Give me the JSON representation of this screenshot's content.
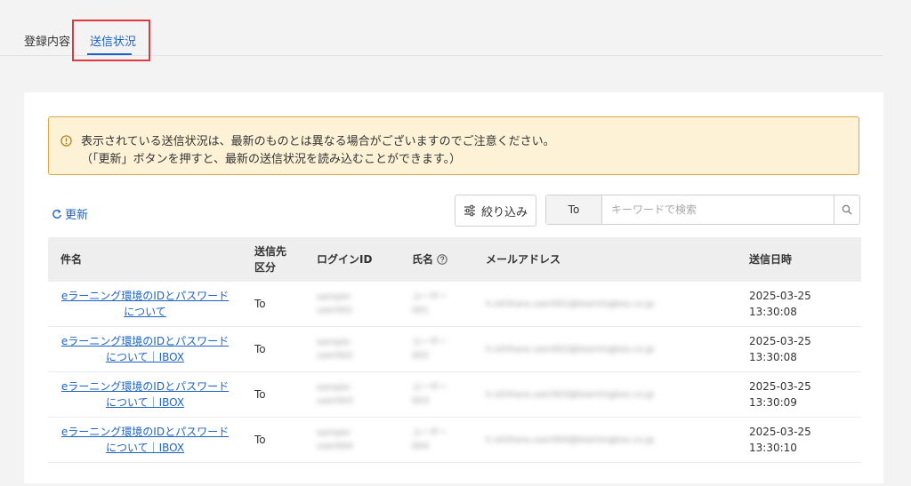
{
  "tabs": {
    "registration": "登録内容",
    "status": "送信状況"
  },
  "notice": {
    "line1": "表示されている送信状況は、最新のものとは異なる場合がございますのでご注意ください。",
    "line2": "（「更新」ボタンを押すと、最新の送信状況を読み込むことができます。）"
  },
  "toolbar": {
    "refresh_label": "更新",
    "filter_label": "絞り込み",
    "search_target": "To",
    "search_placeholder": "キーワードで検索"
  },
  "table": {
    "headers": {
      "subject": "件名",
      "recipient_type_line1": "送信先",
      "recipient_type_line2": "区分",
      "login_id": "ログインID",
      "name": "氏名",
      "email": "メールアドレス",
      "sent_at": "送信日時"
    },
    "rows": [
      {
        "subject_l1": "eラーニング環境のIDとパスワード",
        "subject_l2": "について",
        "type": "To",
        "login_l1": "sample-",
        "login_l2": "user001",
        "name_l1": "ユーザー",
        "name_l2": "001",
        "email": "h.ishihara.user001@learningbox.co.jp",
        "date": "2025-03-25",
        "time": "13:30:08"
      },
      {
        "subject_l1": "eラーニング環境のIDとパスワード",
        "subject_l2": "について｜IBOX",
        "type": "To",
        "login_l1": "sample-",
        "login_l2": "user002",
        "name_l1": "ユーザー",
        "name_l2": "002",
        "email": "h.ishihara.user002@learningbox.co.jp",
        "date": "2025-03-25",
        "time": "13:30:08"
      },
      {
        "subject_l1": "eラーニング環境のIDとパスワード",
        "subject_l2": "について｜IBOX",
        "type": "To",
        "login_l1": "sample-",
        "login_l2": "user003",
        "name_l1": "ユーザー",
        "name_l2": "003",
        "email": "h.ishihara.user003@learningbox.co.jp",
        "date": "2025-03-25",
        "time": "13:30:09"
      },
      {
        "subject_l1": "eラーニング環境のIDとパスワード",
        "subject_l2": "について｜IBOX",
        "type": "To",
        "login_l1": "sample-",
        "login_l2": "user004",
        "name_l1": "ユーザー",
        "name_l2": "004",
        "email": "h.ishihara.user004@learningbox.co.jp",
        "date": "2025-03-25",
        "time": "13:30:10"
      }
    ]
  }
}
